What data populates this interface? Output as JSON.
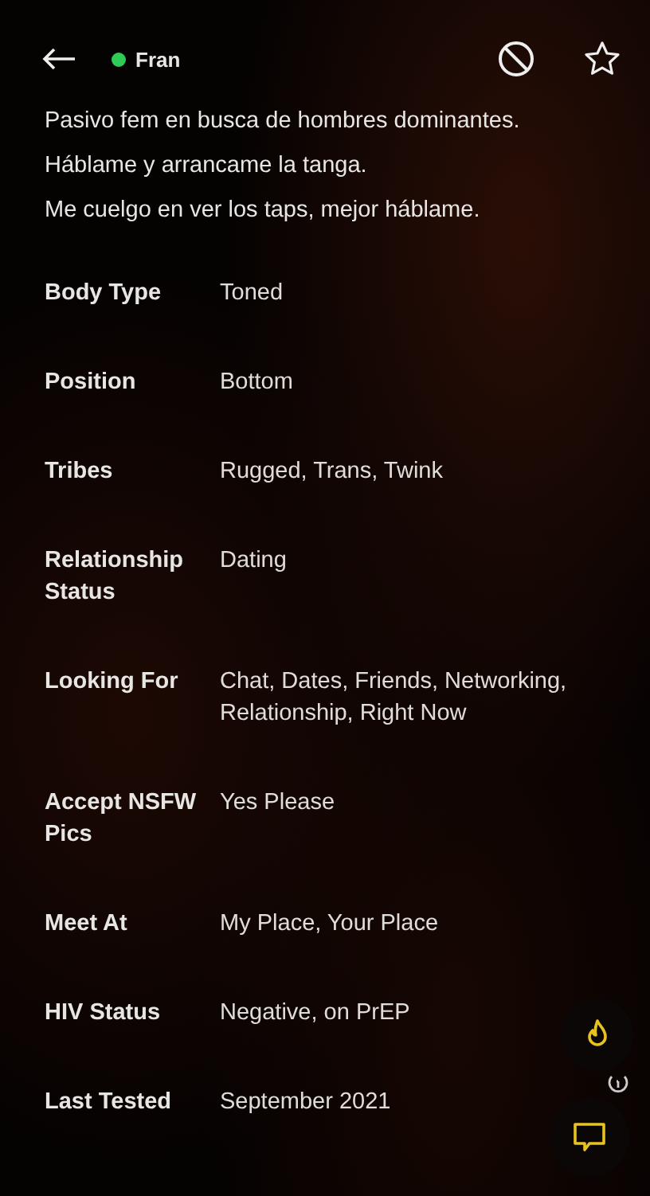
{
  "header": {
    "name": "Fran",
    "online": true,
    "favorited": false
  },
  "bio": [
    "Pasivo fem en busca de hombres dominantes.",
    "Háblame y arrancame la tanga.",
    "Me cuelgo en ver los taps, mejor háblame."
  ],
  "details": [
    {
      "label": "Body Type",
      "value": "Toned"
    },
    {
      "label": "Position",
      "value": "Bottom"
    },
    {
      "label": "Tribes",
      "value": "Rugged, Trans, Twink"
    },
    {
      "label": "Relationship Status",
      "value": "Dating"
    },
    {
      "label": "Looking For",
      "value": "Chat, Dates, Friends, Networking, Relationship, Right Now"
    },
    {
      "label": "Accept NSFW Pics",
      "value": "Yes Please"
    },
    {
      "label": "Meet At",
      "value": "My Place, Your Place"
    },
    {
      "label": "HIV Status",
      "value": "Negative, on PrEP"
    },
    {
      "label": "Last Tested",
      "value": "September 2021"
    }
  ]
}
